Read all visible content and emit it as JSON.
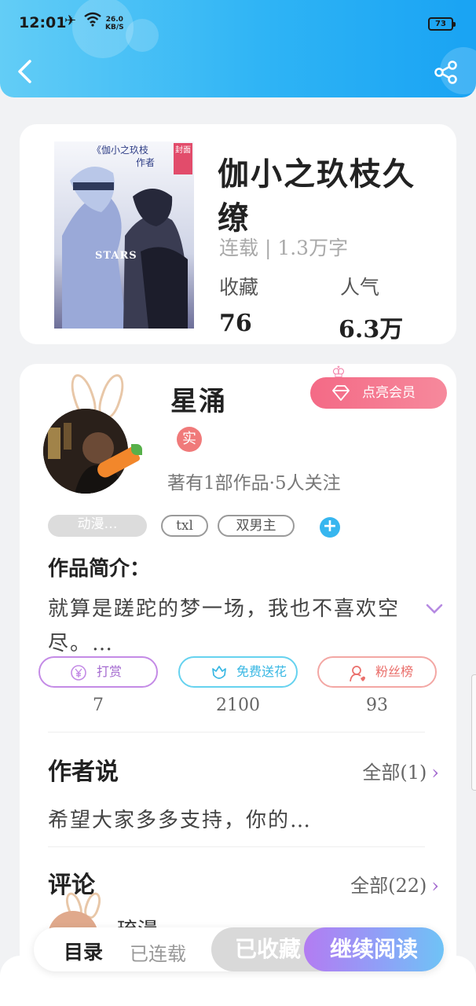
{
  "status_bar": {
    "time": "12:01",
    "speed_value": "26.0",
    "speed_unit": "KB/S",
    "battery": "73"
  },
  "book": {
    "cover_title": "《伽小之玖枝",
    "cover_subtitle": "作者",
    "cover_badge": "封面",
    "cover_art_text": "STARS",
    "title": "伽小之玖枝久缭",
    "meta": "连载 | 1.3万字",
    "stats": [
      {
        "label": "收藏",
        "value": "76"
      },
      {
        "label": "人气",
        "value": "6.3万"
      }
    ]
  },
  "author": {
    "name": "星涌",
    "verified_badge": "实",
    "stats": "著有1部作品·5人关注",
    "vip_button": "点亮会员"
  },
  "tags": {
    "filled": "动漫…",
    "items": [
      "txl",
      "双男主"
    ],
    "add": "+"
  },
  "intro": {
    "title": "作品简介：",
    "text": "就算是蹉跎的梦一场，我也不喜欢空尽。…"
  },
  "actions": [
    {
      "label": "打赏",
      "count": "7",
      "icon": "yen-icon"
    },
    {
      "label": "免费送花",
      "count": "2100",
      "icon": "flower-icon"
    },
    {
      "label": "粉丝榜",
      "count": "93",
      "icon": "fans-icon"
    }
  ],
  "author_says": {
    "title": "作者说",
    "more": "全部(1)",
    "text": "希望大家多多支持，你的…"
  },
  "comments": {
    "title": "评论",
    "more": "全部(22)",
    "first_name": "琉漫"
  },
  "bottom_bar": {
    "catalog": "目录",
    "status": "已连载",
    "collected": "已收藏",
    "continue": "继续阅读"
  },
  "colors": {
    "header_start": "#63cdf6",
    "header_end": "#19a3f3",
    "vip_pink": "#f46a86",
    "tip_purple": "#c48be6",
    "flower_blue": "#66d2ef",
    "fans_red": "#f3a7a4"
  }
}
